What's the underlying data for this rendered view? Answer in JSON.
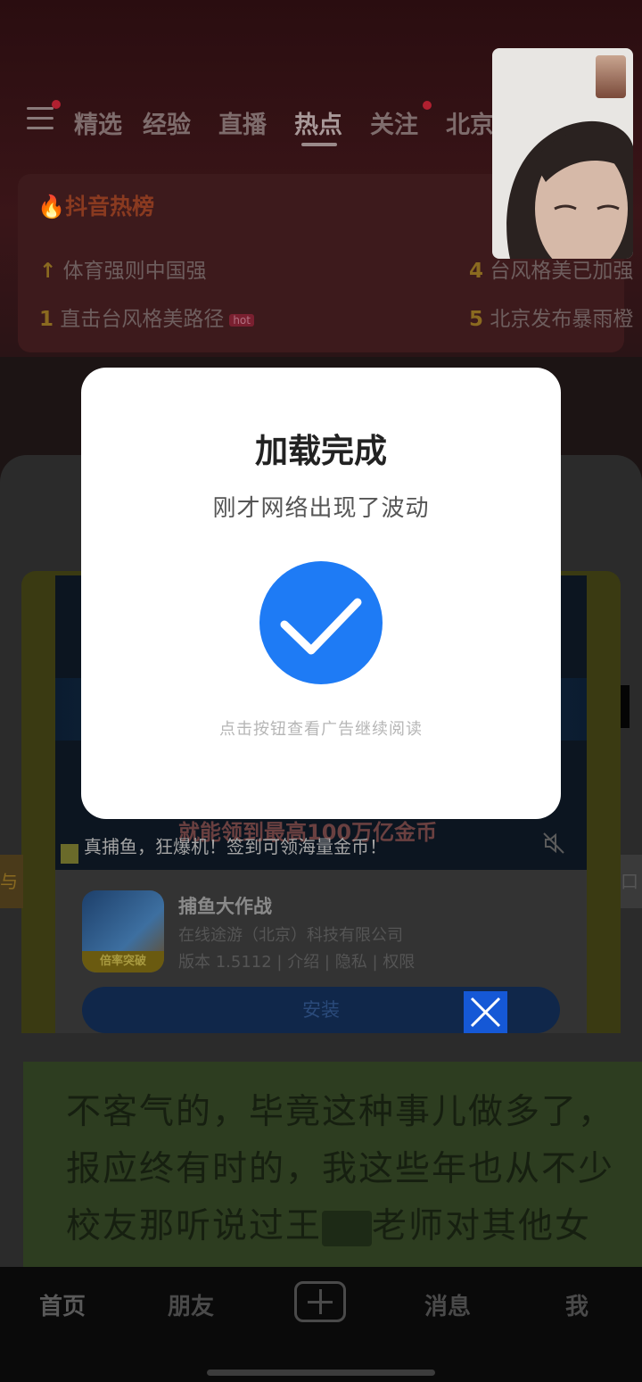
{
  "nav_tabs": [
    "精选",
    "经验",
    "直播",
    "热点",
    "关注",
    "北京"
  ],
  "hot_list": {
    "title": "抖音热榜",
    "left": [
      {
        "rank": "↑",
        "text": "体育强则中国强",
        "badge": ""
      },
      {
        "rank": "1",
        "text": "直击台风格美路径",
        "badge": "hot"
      }
    ],
    "right": [
      {
        "rank": "4",
        "text": "台风格美已加强"
      },
      {
        "rank": "5",
        "text": "北京发布暴雨橙"
      }
    ]
  },
  "ad": {
    "promo_text": "就能领到最高100万亿金币",
    "caption": "真捕鱼，狂爆机！签到可领海量金币！",
    "app_name": "捕鱼大作战",
    "company": "在线途游（北京）科技有限公司",
    "meta": "版本 1.5112 | 介绍 | 隐私 | 权限",
    "install_label": "安装",
    "icon_tag": "倍率突破",
    "side_left": "与",
    "side_right": "口"
  },
  "reader": {
    "line1": "不客气的，毕竟这种事儿做多了，",
    "line2": "报应终有时的，我这些年也从不少",
    "line3_pre": "校友那听说过王",
    "line3_post": "老师对其他女"
  },
  "dialog": {
    "title": "加载完成",
    "subtitle": "刚才网络出现了波动",
    "hint": "点击按钮查看广告继续阅读"
  },
  "bottom_nav": [
    "首页",
    "朋友",
    "消息",
    "我"
  ],
  "colors": {
    "accent_blue": "#1e7bf5",
    "close_button": "#1558d6"
  }
}
